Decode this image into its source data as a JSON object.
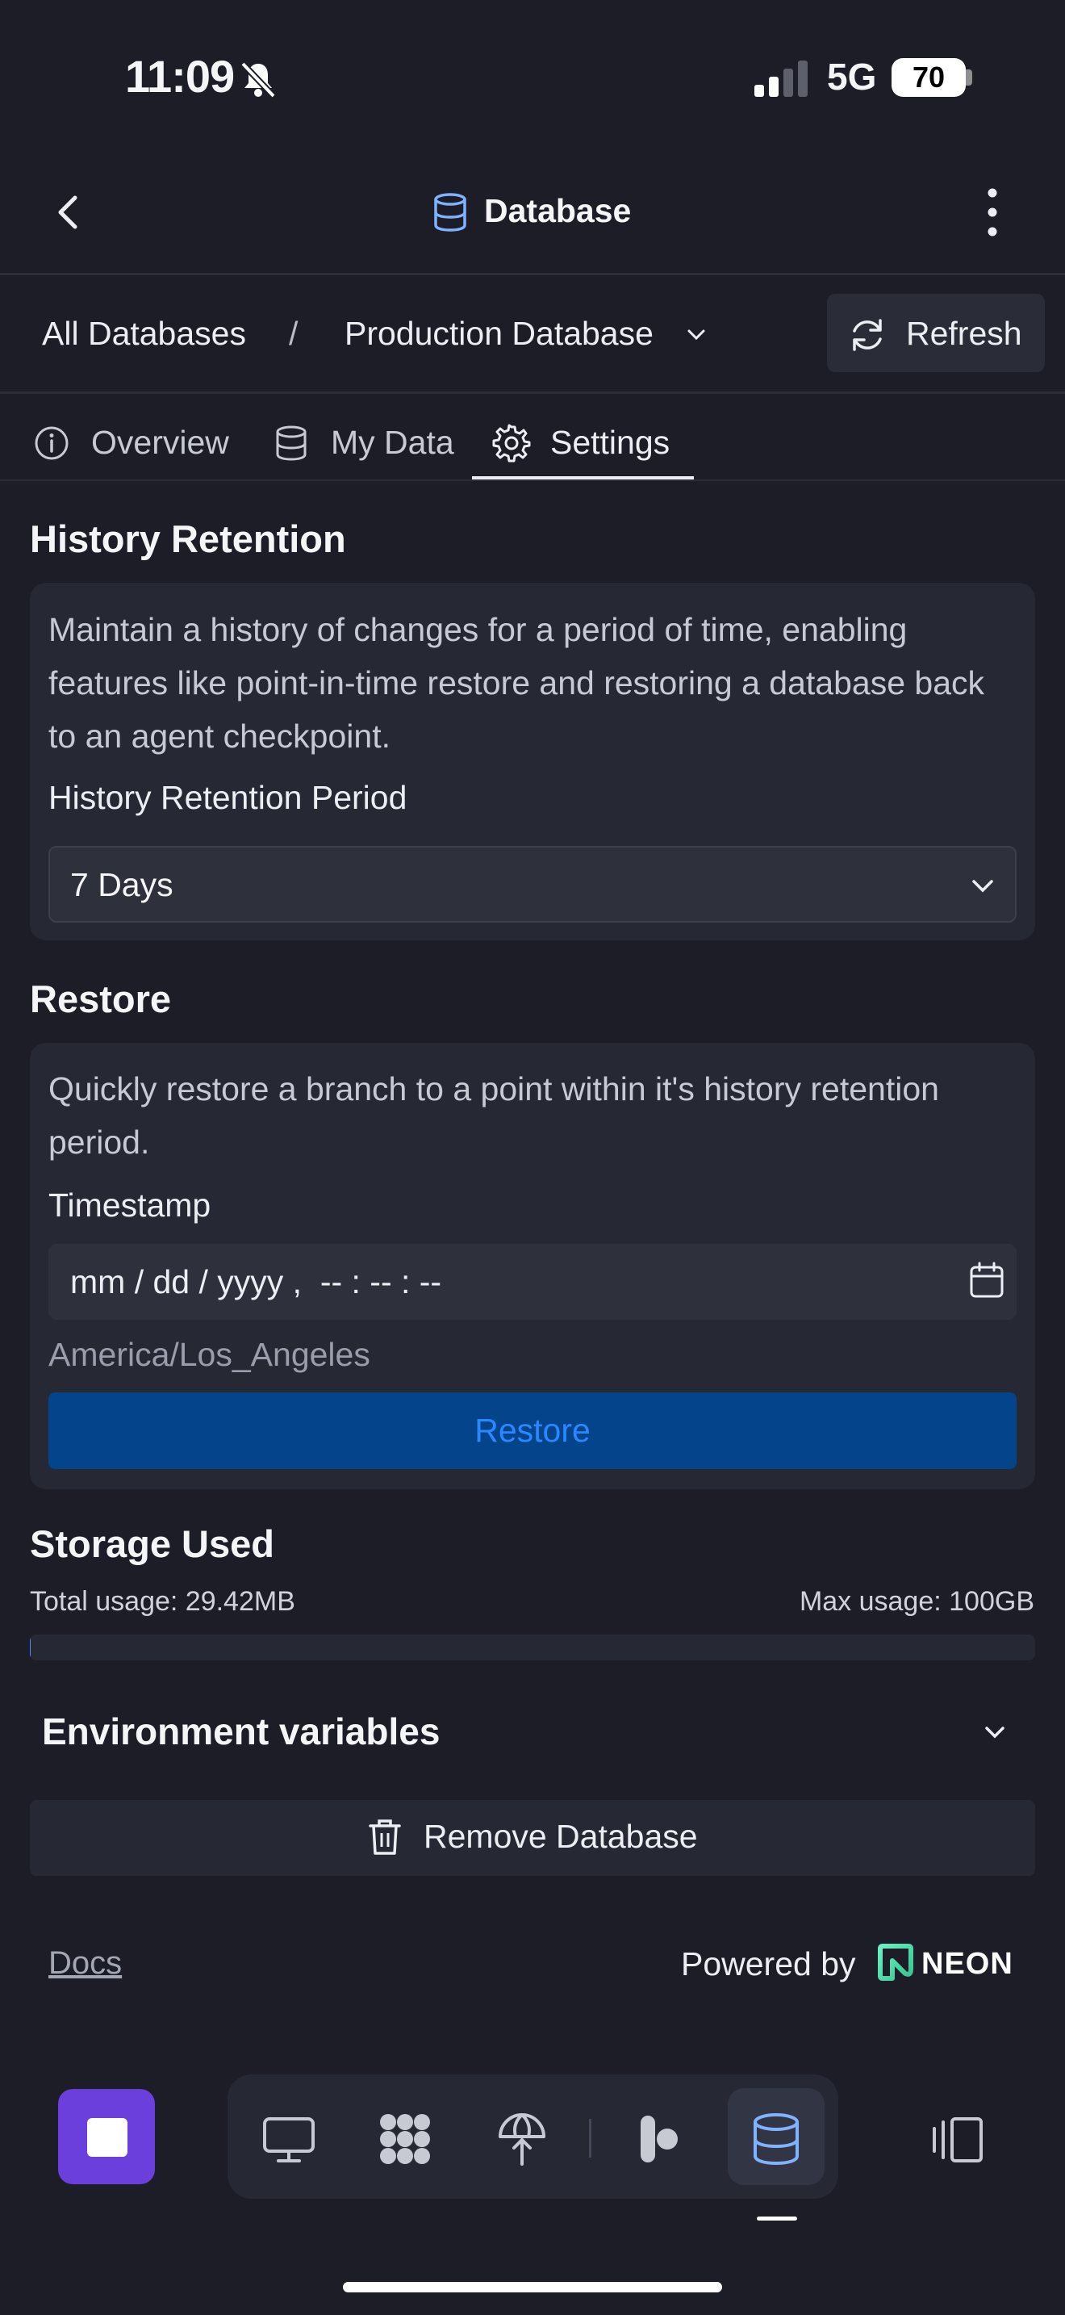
{
  "status_bar": {
    "time": "11:09",
    "network": "5G",
    "battery": "70"
  },
  "top_bar": {
    "title": "Database",
    "icons": [
      "back-icon",
      "database-icon",
      "more-vertical-icon"
    ]
  },
  "breadcrumb": {
    "all": "All Databases",
    "separator": "/",
    "current": "Production Database",
    "refresh_label": "Refresh"
  },
  "tabs": [
    {
      "label": "Overview",
      "icon": "info-icon",
      "active": false
    },
    {
      "label": "My Data",
      "icon": "database-icon",
      "active": false
    },
    {
      "label": "Settings",
      "icon": "gear-icon",
      "active": true
    }
  ],
  "history": {
    "title": "History Retention",
    "description": "Maintain a history of changes for a period of time, enabling features like point-in-time restore and restoring a database back to an agent checkpoint.",
    "period_label": "History Retention Period",
    "period_value": "7 Days"
  },
  "restore": {
    "title": "Restore",
    "description": "Quickly restore a branch to a point within it's history retention period.",
    "timestamp_label": "Timestamp",
    "timestamp_placeholder": "mm / dd / yyyy ,  -- : -- : --",
    "timezone": "America/Los_Angeles",
    "button_label": "Restore"
  },
  "storage": {
    "title": "Storage Used",
    "total": "Total usage: 29.42MB",
    "max": "Max usage: 100GB",
    "fraction": 0.0003
  },
  "env": {
    "title": "Environment variables"
  },
  "remove": {
    "label": "Remove Database"
  },
  "footer": {
    "docs": "Docs",
    "powered_by": "Powered by",
    "brand": "NEON"
  },
  "dock": {
    "icons": [
      "stop-icon",
      "monitor-icon",
      "apps-grid-icon",
      "deploy-icon",
      "agent-icon",
      "database-icon",
      "panel-toggle-icon"
    ],
    "active": "database-icon"
  },
  "colors": {
    "background": "#1c1d27",
    "card": "#262833",
    "restore_button": "#03448b",
    "restore_text": "#2c87ff",
    "stop_button": "#6a3fdc"
  }
}
